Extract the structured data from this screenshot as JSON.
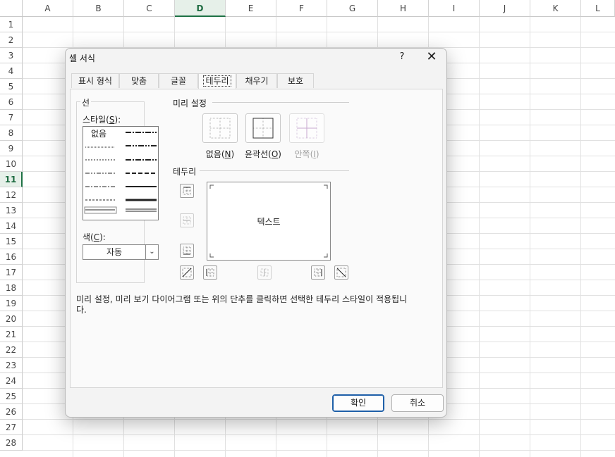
{
  "sheet": {
    "columns": [
      "A",
      "B",
      "C",
      "D",
      "E",
      "F",
      "G",
      "H",
      "I",
      "J",
      "K",
      "L"
    ],
    "rows": [
      "1",
      "2",
      "3",
      "4",
      "5",
      "6",
      "7",
      "8",
      "9",
      "10",
      "11",
      "12",
      "13",
      "14",
      "15",
      "16",
      "17",
      "18",
      "19",
      "20",
      "21",
      "22",
      "23",
      "24",
      "25",
      "26",
      "27",
      "28"
    ],
    "selected_column": "D",
    "selected_row": "11"
  },
  "dialog": {
    "title": "셀 서식",
    "help": "?",
    "close": "✕",
    "tabs": [
      "표시 형식",
      "맞춤",
      "글꼴",
      "테두리",
      "채우기",
      "보호"
    ],
    "active_tab": "테두리",
    "line": {
      "group_label": "선",
      "style_label": "스타일(S):",
      "none_label": "없음",
      "color_label": "색(C):",
      "color_value": "자동"
    },
    "presets": {
      "group_label": "미리 설정",
      "items": [
        "없음(N)",
        "윤곽선(O)",
        "안쪽(I)"
      ]
    },
    "border": {
      "group_label": "테두리",
      "preview_text": "텍스트"
    },
    "description": "미리 설정, 미리 보기 다이어그램 또는 위의 단추를 클릭하면 선택한 테두리 스타일이 적용됩니다.",
    "ok": "확인",
    "cancel": "취소"
  },
  "colors": {
    "accent_green": "#1e7145",
    "primary_button_border": "#1e5fa8"
  }
}
